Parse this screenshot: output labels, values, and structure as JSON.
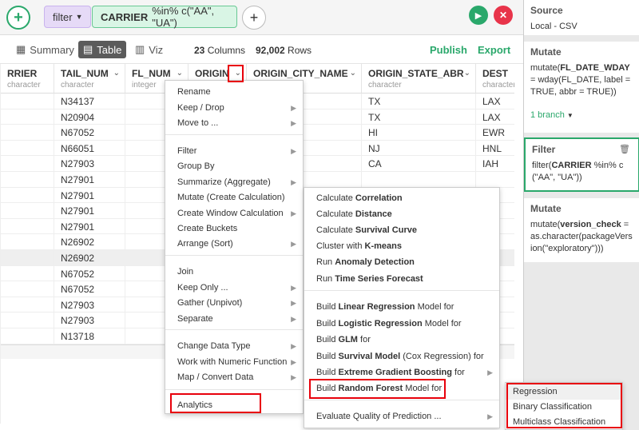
{
  "toolbar": {
    "step_label": "filter",
    "expression_column": "CARRIER",
    "expression_rest": "%in% c(\"AA\", \"UA\")"
  },
  "viewbar": {
    "tab_summary": "Summary",
    "tab_table": "Table",
    "tab_viz": "Viz",
    "columns_count": "23",
    "columns_label": "Columns",
    "rows_count": "92,002",
    "rows_label": "Rows",
    "publish": "Publish",
    "export": "Export"
  },
  "table": {
    "columns": [
      {
        "name": "RRIER",
        "type": "character"
      },
      {
        "name": "TAIL_NUM",
        "type": "character"
      },
      {
        "name": "FL_NUM",
        "type": "integer"
      },
      {
        "name": "ORIGIN",
        "type": ""
      },
      {
        "name": "ORIGIN_CITY_NAME",
        "type": ""
      },
      {
        "name": "ORIGIN_STATE_ABR",
        "type": "character"
      },
      {
        "name": "DEST",
        "type": "character"
      }
    ],
    "tail_num": [
      "N34137",
      "N20904",
      "N67052",
      "N66051",
      "N27903",
      "N27901",
      "N27901",
      "N27901",
      "N27901",
      "N26902",
      "N26902",
      "N67052",
      "N67052",
      "N27903",
      "N27903",
      "N13718"
    ],
    "origin_city_fragment": ", CA",
    "origin_state": [
      "TX",
      "TX",
      "HI",
      "NJ",
      "CA"
    ],
    "dest": [
      "LAX",
      "LAX",
      "EWR",
      "HNL",
      "IAH"
    ],
    "highlighted_row": 10
  },
  "column_menu": {
    "items": [
      "Rename",
      "Keep / Drop",
      "Move to ...",
      "Filter",
      "Group By",
      "Summarize (Aggregate)",
      "Mutate (Create Calculation)",
      "Create Window Calculation",
      "Create Buckets",
      "Arrange (Sort)",
      "Join",
      "Keep Only ...",
      "Gather (Unpivot)",
      "Separate",
      "Change Data Type",
      "Work with Numeric Function",
      "Map / Convert Data",
      "Analytics"
    ]
  },
  "analytics_menu": {
    "items": [
      {
        "pre": "Calculate ",
        "bold": "Correlation",
        "post": ""
      },
      {
        "pre": "Calculate ",
        "bold": "Distance",
        "post": ""
      },
      {
        "pre": "Calculate ",
        "bold": "Survival Curve",
        "post": ""
      },
      {
        "pre": "Cluster with ",
        "bold": "K-means",
        "post": ""
      },
      {
        "pre": "Run ",
        "bold": "Anomaly Detection",
        "post": ""
      },
      {
        "pre": "Run ",
        "bold": "Time Series Forecast",
        "post": ""
      },
      {
        "pre": "Build ",
        "bold": "Linear Regression",
        "post": " Model for"
      },
      {
        "pre": "Build ",
        "bold": "Logistic Regression",
        "post": " Model for"
      },
      {
        "pre": "Build ",
        "bold": "GLM",
        "post": " for"
      },
      {
        "pre": "Build ",
        "bold": "Survival Model",
        "post": " (Cox Regression) for"
      },
      {
        "pre": "Build ",
        "bold": "Extreme Gradient Boosting",
        "post": " for"
      },
      {
        "pre": "Build ",
        "bold": "Random Forest",
        "post": " Model for"
      },
      {
        "pre": "Evaluate Quality of Prediction ...",
        "bold": "",
        "post": ""
      }
    ]
  },
  "random_forest_menu": {
    "items": [
      "Regression",
      "Binary Classification",
      "Multiclass Classification"
    ]
  },
  "right_panel": {
    "source_title": "Source",
    "source_value": "Local - CSV",
    "mutate1_title": "Mutate",
    "mutate1_pre": "mutate(",
    "mutate1_bold": "FL_DATE_WDAY",
    "mutate1_post": " = wday(FL_DATE, label = TRUE, abbr = TRUE))",
    "branch_link": "1 branch",
    "filter_title": "Filter",
    "filter_pre": "filter(",
    "filter_bold": "CARRIER",
    "filter_post": " %in% c(\"AA\", \"UA\"))",
    "mutate2_title": "Mutate",
    "mutate2_pre": "mutate(",
    "mutate2_bold": "version_check",
    "mutate2_post": " = as.character(packageVersion(\"exploratory\")))"
  }
}
